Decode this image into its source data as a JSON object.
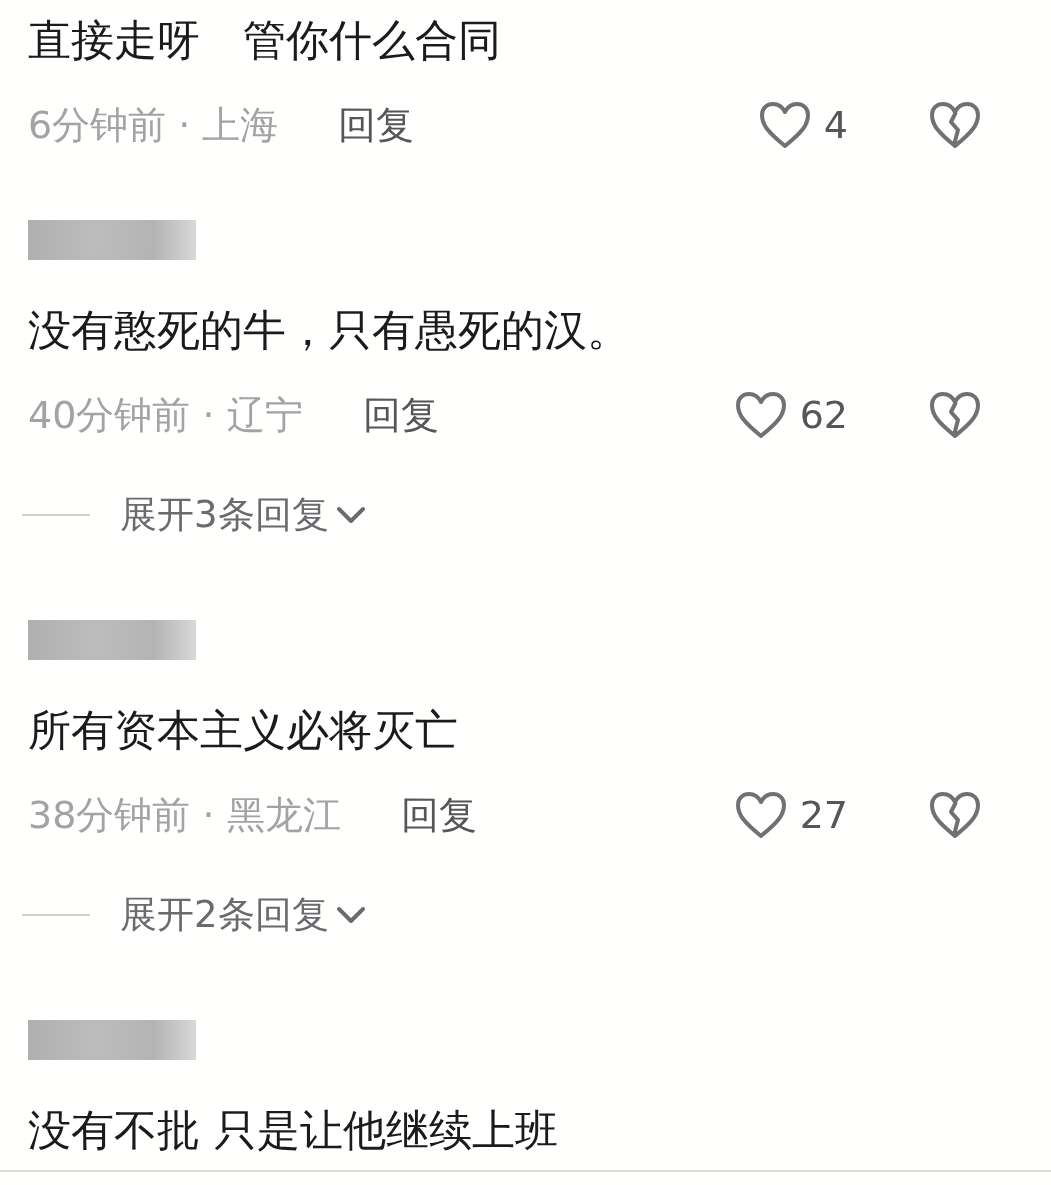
{
  "comments": [
    {
      "text": "直接走呀　管你什么合同",
      "time_location": "6分钟前 · 上海",
      "reply_label": "回复",
      "likes": "4"
    },
    {
      "name_redacted": true,
      "text": "没有憨死的牛，只有愚死的汉。",
      "time_location": "40分钟前 · 辽宁",
      "reply_label": "回复",
      "likes": "62",
      "expand": "展开3条回复"
    },
    {
      "name_redacted": true,
      "text": "所有资本主义必将灭亡",
      "time_location": "38分钟前 · 黑龙江",
      "reply_label": "回复",
      "likes": "27",
      "expand": "展开2条回复"
    },
    {
      "name_redacted": true,
      "text": "没有不批 只是让他继续上班"
    }
  ]
}
